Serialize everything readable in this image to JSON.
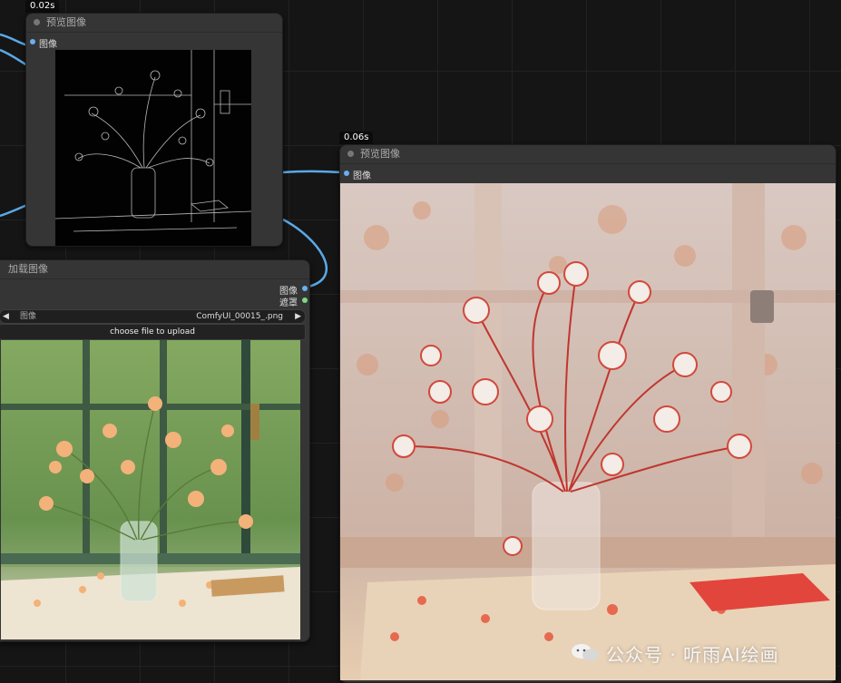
{
  "canvas": {
    "background": "#151515",
    "link_color": "#5aa9e6"
  },
  "node_edge_preview": {
    "timing": "0.02s",
    "title": "预览图像",
    "input_label": "图像",
    "image_description": "Edge-detection line drawing of a vase of flowers by a window"
  },
  "node_main_preview": {
    "timing": "0.06s",
    "title": "预览图像",
    "input_label": "图像",
    "image_description": "Red and white paper-cut flowers in a glass vase on a table by a window"
  },
  "node_load_image": {
    "title": "加载图像",
    "outputs": [
      {
        "label": "图像",
        "color": "#6ab0f0"
      },
      {
        "label": "遮罩",
        "color": "#7ed97e"
      }
    ],
    "combo": {
      "label": "图像",
      "value": "ComfyUI_00015_.png",
      "left_arrow": "◀",
      "right_arrow": "▶"
    },
    "upload_label": "choose file to upload",
    "image_description": "Peach flowers in a glass vase on a sunlit windowsill table"
  },
  "watermark": {
    "text": "公众号 · 听雨AI绘画"
  }
}
